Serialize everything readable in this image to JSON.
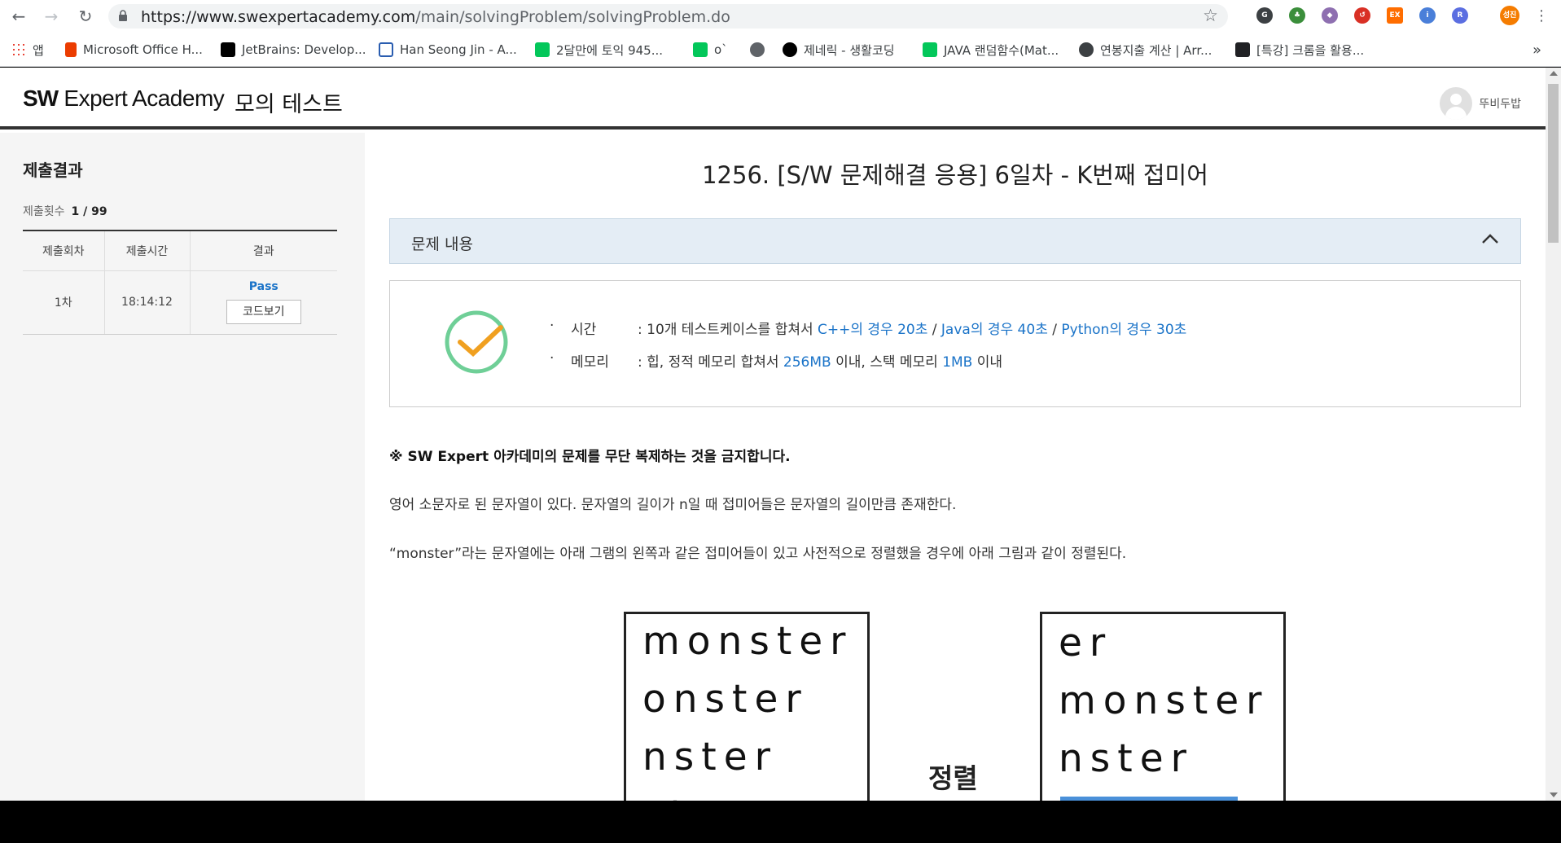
{
  "browser": {
    "url_domain": "https://www.swexpertacademy.com",
    "url_path": "/main/solvingProblem/solvingProblem.do",
    "bookmarks": [
      "앱",
      "Microsoft Office H...",
      "JetBrains: Develop...",
      "Han Seong Jin - A...",
      "2달만에 토익 945...",
      "o`",
      "",
      "제네릭 - 생활코딩",
      "JAVA 랜덤함수(Mat...",
      "연봉지출 계산 | Arr...",
      "[특강] 크롬을 활용..."
    ],
    "more": "»",
    "profile_badge": "성진"
  },
  "header": {
    "logo_bold": "SW",
    "logo_rest": " Expert Academy",
    "section": "모의 테스트",
    "user_name": "뚜비두밥"
  },
  "sidebar": {
    "title": "제출결과",
    "count_label": "제출횟수",
    "count_value": "1 / 99",
    "columns": [
      "제출회차",
      "제출시간",
      "결과"
    ],
    "rows": [
      {
        "round": "1차",
        "time": "18:14:12",
        "result": "Pass",
        "code_button": "코드보기"
      }
    ]
  },
  "problem": {
    "title": "1256. [S/W 문제해결 응용] 6일차 - K번째 접미어",
    "panel_header": "문제 내용",
    "limits": {
      "time_label": "시간",
      "time_prefix": ": 10개 테스트케이스를 합쳐서 ",
      "time_cpp": "C++의 경우 20초",
      "time_java": "Java의 경우 40초",
      "time_python": "Python의 경우 30초",
      "sep": " / ",
      "memory_label": "메모리",
      "memory_prefix": ": 힙, 정적 메모리 합쳐서 ",
      "memory_heap": "256MB",
      "memory_mid": " 이내, 스택 메모리 ",
      "memory_stack": "1MB",
      "memory_suffix": " 이내"
    },
    "warning": "※ SW Expert 아카데미의 문제를 무단 복제하는 것을 금지합니다.",
    "para1": "영어 소문자로 된 문자열이 있다. 문자열의 길이가 n일 때 접미어들은 문자열의 길이만큼 존재한다.",
    "para2": "“monster”라는 문자열에는 아래 그램의 왼쪽과 같은 접미어들이 있고 사전적으로 정렬했을 경우에 아래 그림과 같이 정렬된다.",
    "figure": {
      "left_lines": [
        "monster",
        "onster",
        "nster",
        "ster"
      ],
      "right_lines": [
        "er",
        "monster",
        "nster"
      ],
      "arrow_label": "정렬"
    }
  },
  "colors": {
    "accent": "#1a73c8",
    "panel_bg": "#e4edf5",
    "check_green": "#6fcf97",
    "check_orange": "#f0a020"
  }
}
